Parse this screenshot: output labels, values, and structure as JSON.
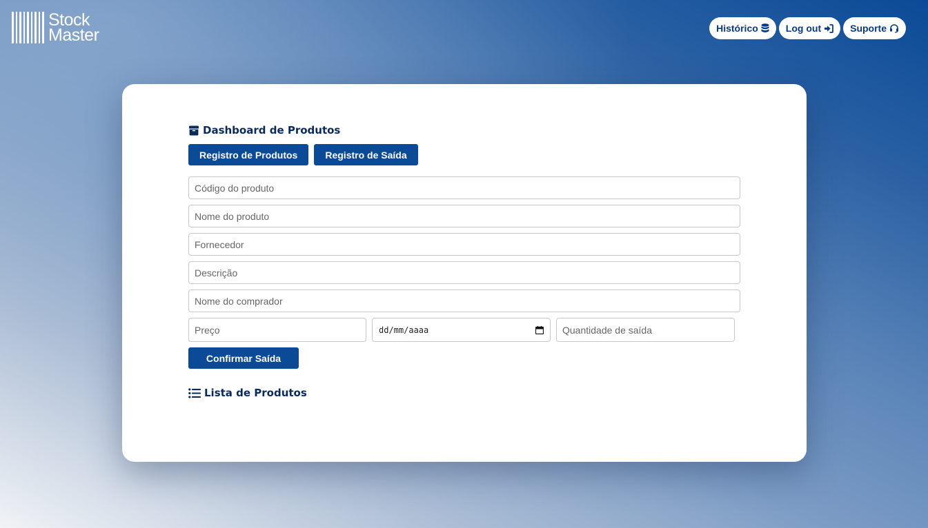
{
  "brand": {
    "line1": "Stock",
    "line2": "Master",
    "color": "#ffffff"
  },
  "nav": {
    "historico": "Histórico",
    "logout": "Log out",
    "suporte": "Suporte"
  },
  "dashboard": {
    "title": "Dashboard de Produtos",
    "tabs": {
      "registro_produtos": "Registro de Produtos",
      "registro_saida": "Registro de Saída"
    }
  },
  "form": {
    "codigo_placeholder": "Código do produto",
    "nome_placeholder": "Nome do produto",
    "fornecedor_placeholder": "Fornecedor",
    "descricao_placeholder": "Descrição",
    "comprador_placeholder": "Nome do comprador",
    "preco_placeholder": "Preço",
    "data_placeholder": "dd/mm/aaaa",
    "quantidade_placeholder": "Quantidade de saída",
    "confirm_label": "Confirmar Saída"
  },
  "list": {
    "title": "Lista de Produtos"
  },
  "colors": {
    "primary": "#0b4a97",
    "heading": "#0a2a5e",
    "nav_text": "#073a86",
    "border": "#c6c8cc"
  },
  "icons": {
    "brand": "barcode-icon",
    "historico": "database-icon",
    "logout": "sign-in-icon",
    "suporte": "headset-icon",
    "dashboard": "box-icon",
    "list": "list-icon",
    "date": "calendar-icon"
  }
}
